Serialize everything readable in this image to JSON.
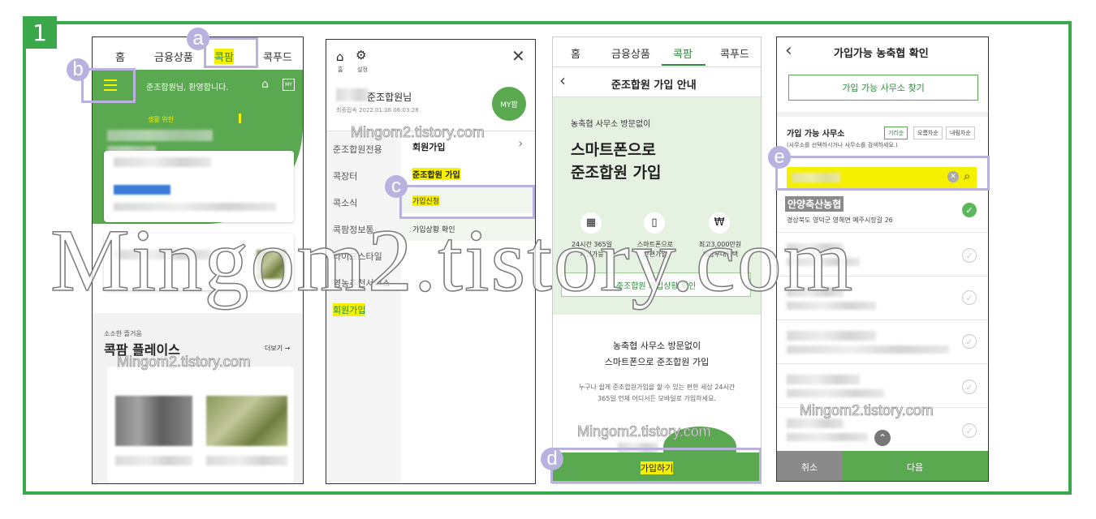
{
  "step_number": "1",
  "annotations": {
    "a": "a",
    "b": "b",
    "c": "c",
    "d": "d",
    "e": "e"
  },
  "watermark": {
    "big": "Mingom2.tistory.com",
    "small": "Mingom2.tistory.com"
  },
  "colors": {
    "frame": "#3aa84b",
    "green": "#5aa84f",
    "highlight": "#f4f000",
    "annotation": "#b8b2e0"
  },
  "screen1": {
    "tabs": [
      "홈",
      "금융상품",
      "콕팜",
      "콕푸드"
    ],
    "greeting": "준조합원님, 환영합니다.",
    "promo_small": "생활 위한",
    "section_caption": "소소한 즐거움",
    "section_title": "콕팜 플레이스",
    "more_link": "더보기 →"
  },
  "screen2": {
    "home_label": "홈",
    "settings_label": "설정",
    "user_name": "준조합원님",
    "last_login": "최종접속 2022.01.06 06:03:28",
    "my_badge": "MY팜",
    "menu": [
      "준조합원전용",
      "콕장터",
      "콕소식",
      "콕팜정보통",
      "라이프스타일",
      "영농추천서비스",
      "회원가입"
    ],
    "submenu_header": "회원가입",
    "submenu": [
      "준조합원 가입",
      "가입신청",
      "가입상황 확인"
    ]
  },
  "screen3": {
    "tabs": [
      "홈",
      "금융상품",
      "콕팜",
      "콕푸드"
    ],
    "title": "준조합원 가입 안내",
    "hero_small": "농축협 사무소 방문없이",
    "hero_big_1": "스마트폰으로",
    "hero_big_2": "준조합원 가입",
    "features": [
      {
        "icon": "calendar-icon",
        "line1": "24시간 365일",
        "line2": "가입가능"
      },
      {
        "icon": "smartphone-icon",
        "line1": "스마트폰으로",
        "line2": "간편가입"
      },
      {
        "icon": "money-bag-icon",
        "line1": "최고3,000만원",
        "line2": "세금우대혜택"
      }
    ],
    "status_button": "준조합원 가입상황 확인",
    "body_title_1": "농축협 사무소 방문없이",
    "body_title_2": "스마트폰으로 준조합원 가입",
    "body_text_1": "누구나 쉽게 준조합원가입을 할 수 있는 편한 세상 24시간",
    "body_text_2": "365일 언제 어디서든 모바일로 가입하세요.",
    "join_button": "가입하기"
  },
  "screen4": {
    "title": "가입가능 농축협 확인",
    "find_button": "가입 가능 사무소 찾기",
    "section_label": "가입 가능 사무소",
    "sort_options": [
      "거리순",
      "오름차순",
      "내림차순"
    ],
    "hint": "(사무소를 선택하시거나 사무소를 검색하세요.)",
    "selected_office": "안양축산농협",
    "selected_address": "경상북도 영덕군 영해면 예주시장길 26",
    "cancel_button": "취소",
    "next_button": "다음"
  }
}
